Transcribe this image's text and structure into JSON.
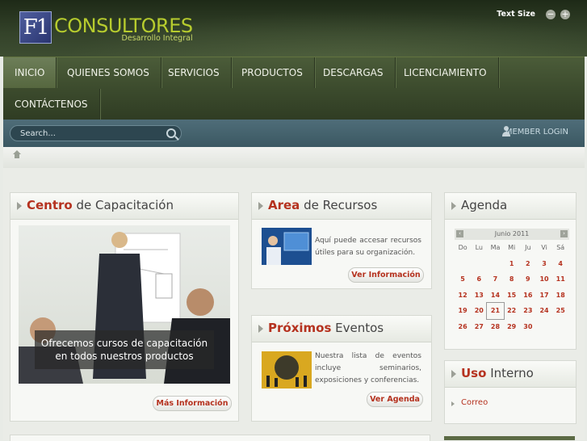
{
  "header": {
    "logo_mark": "F1",
    "logo_name": "CONSULTORES",
    "logo_tagline": "Desarrollo Integral",
    "text_size_label": "Text Size",
    "text_size_decrease": "−",
    "text_size_increase": "+"
  },
  "nav": {
    "items": [
      {
        "label": "INICIO"
      },
      {
        "label": "QUIENES SOMOS"
      },
      {
        "label": "SERVICIOS"
      },
      {
        "label": "PRODUCTOS"
      },
      {
        "label": "DESCARGAS"
      },
      {
        "label": "LICENCIAMIENTO"
      },
      {
        "label": "CONTÁCTENOS"
      }
    ]
  },
  "search": {
    "placeholder": "Search..."
  },
  "member_login": "MEMBER LOGIN",
  "training": {
    "title_highlight": "Centro",
    "title_rest": " de Capacitación",
    "caption": "Ofrecemos cursos de capacitación en todos nuestros productos",
    "button": "Más Información"
  },
  "resources": {
    "title_highlight": "Area",
    "title_rest": " de Recursos",
    "text": "Aquí puede accesar recursos útiles para su organización.",
    "button": "Ver Información"
  },
  "events": {
    "title_highlight": "Próximos",
    "title_rest": " Eventos",
    "text": "Nuestra lista de eventos incluye seminarios, exposiciones y conferencias.",
    "button": "Ver Agenda"
  },
  "agenda": {
    "title": "Agenda",
    "month": "Junio 2011",
    "prev": "‹",
    "next": "›",
    "weekdays": [
      "Do",
      "Lu",
      "Ma",
      "Mi",
      "Ju",
      "Vi",
      "Sá"
    ],
    "weeks": [
      [
        "",
        "",
        "",
        "1",
        "2",
        "3",
        "4"
      ],
      [
        "5",
        "6",
        "7",
        "8",
        "9",
        "10",
        "11"
      ],
      [
        "12",
        "13",
        "14",
        "15",
        "16",
        "17",
        "18"
      ],
      [
        "19",
        "20",
        "21",
        "22",
        "23",
        "24",
        "25"
      ],
      [
        "26",
        "27",
        "28",
        "29",
        "30",
        "",
        ""
      ]
    ],
    "today": "21"
  },
  "internal": {
    "title_highlight": "Uso",
    "title_rest": " Interno",
    "link": "Correo"
  },
  "colors": {
    "accent": "#b5321f",
    "logo_green": "#b7cc2e"
  }
}
